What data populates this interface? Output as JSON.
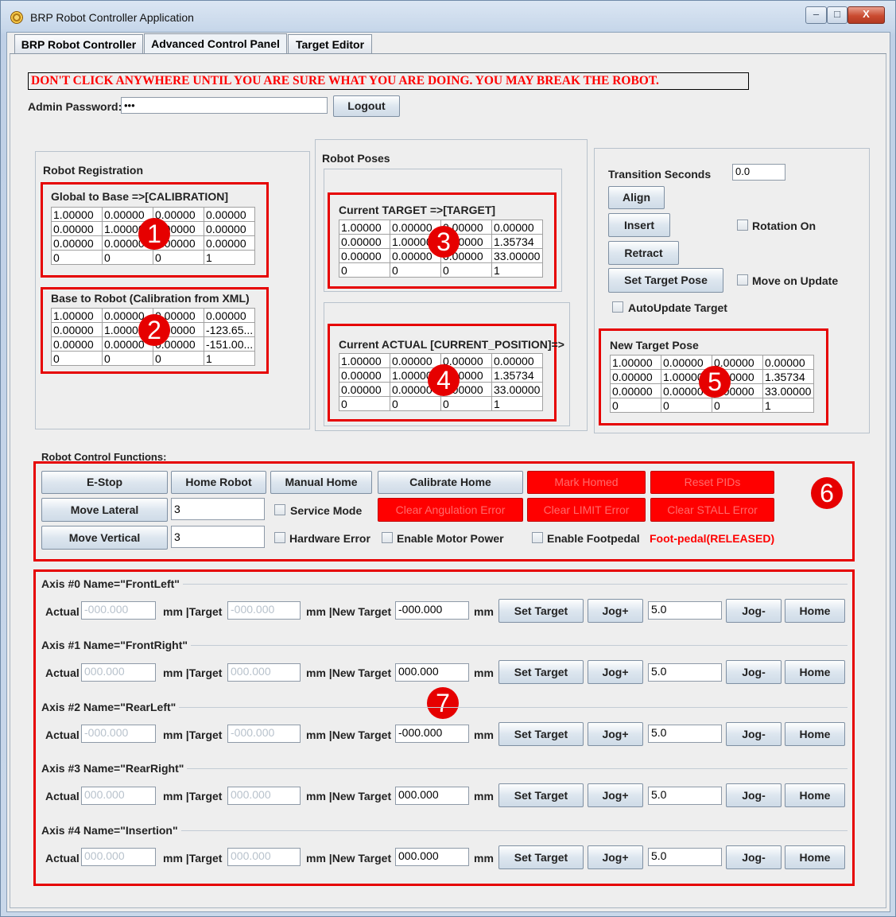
{
  "window": {
    "title": "BRP Robot Controller Application",
    "buttons": {
      "minimize": "‒",
      "maximize": "□",
      "close": "X"
    }
  },
  "tabs": [
    "BRP Robot Controller",
    "Advanced Control Panel",
    "Target Editor"
  ],
  "warning": "DON'T CLICK ANYWHERE UNTIL YOU ARE SURE WHAT YOU ARE DOING. YOU MAY BREAK THE ROBOT.",
  "admin": {
    "label": "Admin Password:",
    "value": "•••",
    "logout_label": "Logout"
  },
  "registration": {
    "title": "Robot Registration",
    "global_to_base": {
      "title": "Global to Base  =>[CALIBRATION]",
      "rows": [
        [
          "1.00000",
          "0.00000",
          "0.00000",
          "0.00000"
        ],
        [
          "0.00000",
          "1.00000",
          "0.00000",
          "0.00000"
        ],
        [
          "0.00000",
          "0.00000",
          "0.00000",
          "0.00000"
        ],
        [
          "0",
          "0",
          "0",
          "1"
        ]
      ]
    },
    "base_to_robot": {
      "title": "Base to Robot  (Calibration from XML)",
      "rows": [
        [
          "1.00000",
          "0.00000",
          "0.00000",
          "0.00000"
        ],
        [
          "0.00000",
          "1.00000",
          "0.00000",
          "-123.65..."
        ],
        [
          "0.00000",
          "0.00000",
          "0.00000",
          "-151.00..."
        ],
        [
          "0",
          "0",
          "0",
          "1"
        ]
      ]
    }
  },
  "poses": {
    "title": "Robot Poses",
    "current_target": {
      "title": "Current TARGET  =>[TARGET]",
      "rows": [
        [
          "1.00000",
          "0.00000",
          "0.00000",
          "0.00000"
        ],
        [
          "0.00000",
          "1.00000",
          "0.00000",
          "1.35734"
        ],
        [
          "0.00000",
          "0.00000",
          "0.00000",
          "33.00000"
        ],
        [
          "0",
          "0",
          "0",
          "1"
        ]
      ]
    },
    "current_actual": {
      "title": "Current ACTUAL [CURRENT_POSITION]=>",
      "rows": [
        [
          "1.00000",
          "0.00000",
          "0.00000",
          "0.00000"
        ],
        [
          "0.00000",
          "1.00000",
          "0.00000",
          "1.35734"
        ],
        [
          "0.00000",
          "0.00000",
          "0.00000",
          "33.00000"
        ],
        [
          "0",
          "0",
          "0",
          "1"
        ]
      ]
    }
  },
  "transition": {
    "seconds_label": "Transition Seconds",
    "seconds_value": "0.0",
    "align": "Align",
    "insert": "Insert",
    "retract": "Retract",
    "set_target_pose": "Set Target Pose",
    "rotation_on": "Rotation On",
    "move_on_update": "Move on Update",
    "autoupdate_target": "AutoUpdate Target",
    "new_target_pose": {
      "title": "New Target Pose",
      "rows": [
        [
          "1.00000",
          "0.00000",
          "0.00000",
          "0.00000"
        ],
        [
          "0.00000",
          "1.00000",
          "0.00000",
          "1.35734"
        ],
        [
          "0.00000",
          "0.00000",
          "0.00000",
          "33.00000"
        ],
        [
          "0",
          "0",
          "0",
          "1"
        ]
      ]
    }
  },
  "control": {
    "title": "Robot Control Functions:",
    "estop": "E-Stop",
    "home_robot": "Home Robot",
    "manual_home": "Manual Home",
    "calibrate_home": "Calibrate Home",
    "mark_homed": "Mark Homed",
    "reset_pids": "Reset PIDs",
    "move_lateral": "Move Lateral",
    "lateral_value": "3",
    "service_mode": "Service Mode",
    "clear_angulation_error": "Clear Angulation Error",
    "clear_limit_error": "Clear LIMIT Error",
    "clear_stall_error": "Clear STALL Error",
    "move_vertical": "Move Vertical",
    "vertical_value": "3",
    "hardware_error": "Hardware Error",
    "enable_motor_power": "Enable Motor Power",
    "enable_footpedal": "Enable Footpedal",
    "foot_pedal_status": "Foot-pedal(RELEASED)"
  },
  "axis_labels": {
    "actual": "Actual",
    "mm_target": "mm |Target",
    "mm_new_target": "mm |New Target",
    "mm": "mm",
    "set_target": "Set Target",
    "jog_plus": "Jog+",
    "jog_minus": "Jog-",
    "home": "Home"
  },
  "axes": [
    {
      "title": "Axis #0 Name=\"FrontLeft\"",
      "actual": "-000.000",
      "target": "-000.000",
      "new_target": "-000.000",
      "jog_step": "5.0"
    },
    {
      "title": "Axis #1 Name=\"FrontRight\"",
      "actual": "000.000",
      "target": "000.000",
      "new_target": "000.000",
      "jog_step": "5.0"
    },
    {
      "title": "Axis #2 Name=\"RearLeft\"",
      "actual": "-000.000",
      "target": "-000.000",
      "new_target": "-000.000",
      "jog_step": "5.0"
    },
    {
      "title": "Axis #3 Name=\"RearRight\"",
      "actual": "000.000",
      "target": "000.000",
      "new_target": "000.000",
      "jog_step": "5.0"
    },
    {
      "title": "Axis #4 Name=\"Insertion\"",
      "actual": "000.000",
      "target": "000.000",
      "new_target": "000.000",
      "jog_step": "5.0"
    }
  ],
  "annotations": [
    "1",
    "2",
    "3",
    "4",
    "5",
    "6",
    "7"
  ],
  "colors": {
    "highlight": "#e60000",
    "warning_text": "#ff0000",
    "red_button": "#ff0000"
  }
}
